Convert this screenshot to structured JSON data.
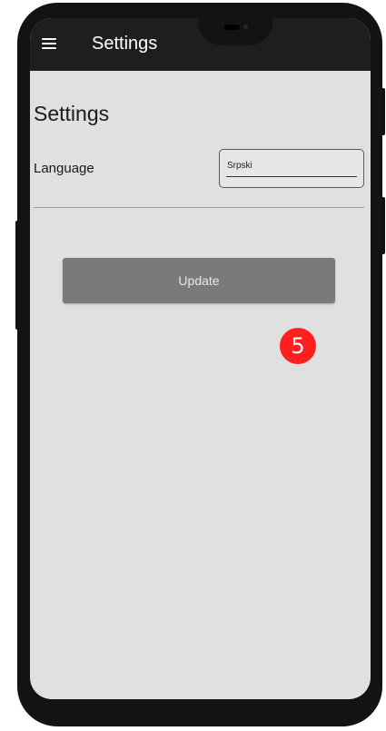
{
  "appbar": {
    "title": "Settings",
    "menu_icon": "hamburger-menu-icon"
  },
  "page": {
    "heading": "Settings"
  },
  "language": {
    "label": "Language",
    "value": "Srpski"
  },
  "actions": {
    "update_label": "Update"
  },
  "annotation": {
    "step_number": "5",
    "color": "#ff1f1f"
  },
  "colors": {
    "appbar": "#1e1e1e",
    "screen_background": "#e0e0e0",
    "button": "#7a7a7a"
  }
}
